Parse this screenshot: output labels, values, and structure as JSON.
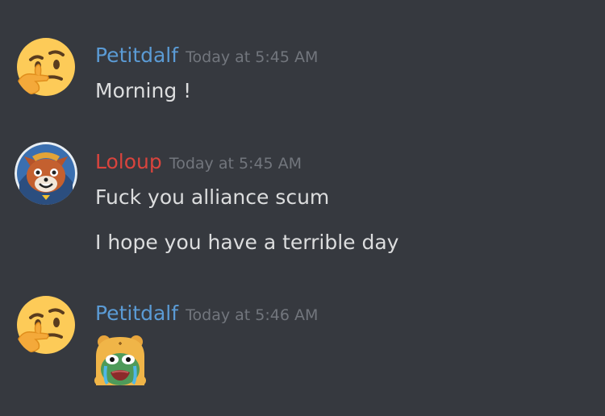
{
  "messages": [
    {
      "username": "Petitdalf",
      "username_color": "#5b9bd5",
      "timestamp": "Today at 5:45 AM",
      "avatar_icon": "thinking-face-icon",
      "lines": [
        "Morning !"
      ]
    },
    {
      "username": "Loloup",
      "username_color": "#d9443d",
      "timestamp": "Today at 5:45 AM",
      "avatar_icon": "red-panda-avatar",
      "lines": [
        "Fuck you alliance scum",
        "I hope you have a terrible day"
      ]
    },
    {
      "username": "Petitdalf",
      "username_color": "#5b9bd5",
      "timestamp": "Today at 5:46 AM",
      "avatar_icon": "thinking-face-icon",
      "attachment_icon": "crying-pepe-emoji"
    }
  ],
  "theme": {
    "background": "#36393f",
    "text": "#dcddde",
    "timestamp": "#72767d"
  }
}
